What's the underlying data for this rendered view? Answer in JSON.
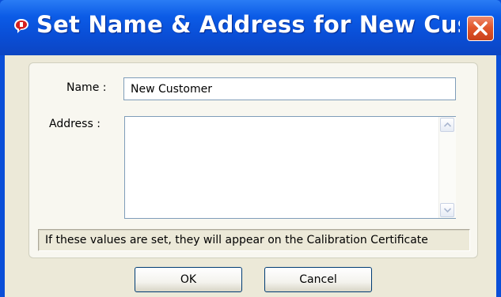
{
  "window": {
    "title": "Set Name & Address for New Custo...",
    "icon": "app-icon",
    "close_icon": "close-icon"
  },
  "form": {
    "name_label": "Name :",
    "name_value": "New Customer",
    "address_label": "Address :",
    "address_value": "",
    "hint": "If these values are set, they will appear on the Calibration Certificate"
  },
  "buttons": {
    "ok_label": "OK",
    "cancel_label": "Cancel"
  },
  "colors": {
    "titlebar": "#0a4fd8",
    "close_button": "#e2582c",
    "client_bg": "#ece9d8",
    "input_border": "#7f9db9"
  }
}
